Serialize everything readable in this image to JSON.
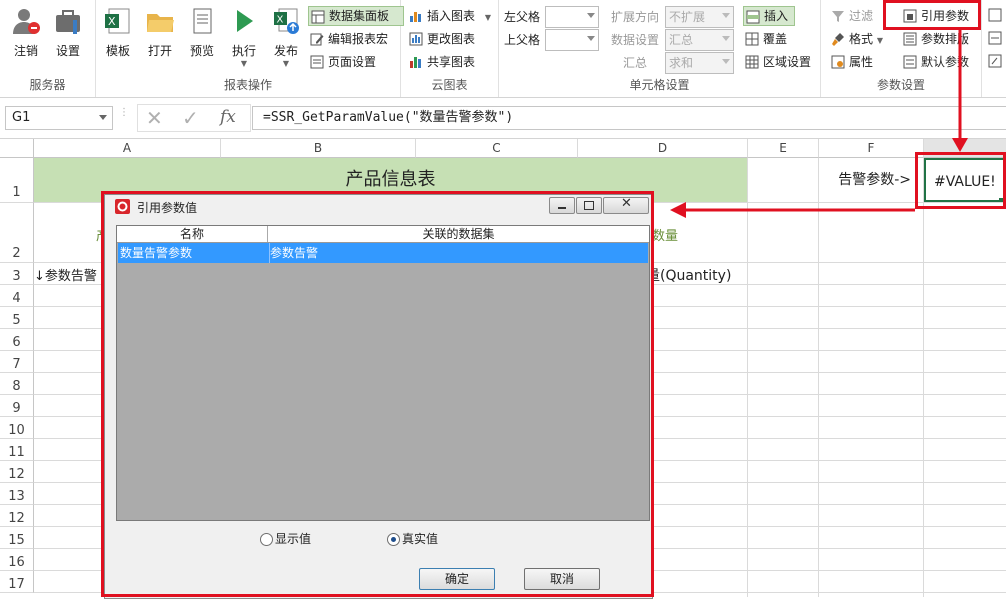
{
  "ribbon": {
    "server_group": {
      "label": "服务器",
      "logout": "注销",
      "settings": "设置"
    },
    "report_ops": {
      "label": "报表操作",
      "template": "模板",
      "open": "打开",
      "preview": "预览",
      "execute": "执行",
      "publish": "发布",
      "dataset_panel": "数据集面板",
      "edit_macro": "编辑报表宏",
      "page_setup": "页面设置"
    },
    "cloud_chart": {
      "label": "云图表",
      "insert_chart": "插入图表",
      "change_chart": "更改图表",
      "share_chart": "共享图表"
    },
    "cell_settings": {
      "label": "单元格设置",
      "left_parent": "左父格",
      "top_parent": "上父格",
      "expand_dir": "扩展方向",
      "expand_val": "不扩展",
      "data_setting": "数据设置",
      "data_val": "汇总",
      "summary": "汇总",
      "summary_val": "求和",
      "insert": "插入",
      "overwrite": "覆盖",
      "region_setting": "区域设置"
    },
    "param_settings": {
      "label": "参数设置",
      "filter": "过滤",
      "format": "格式",
      "property": "属性",
      "ref_param": "引用参数",
      "param_order": "参数排版",
      "default_param": "默认参数"
    }
  },
  "formula_bar": {
    "cell_ref": "G1",
    "fx": "fx",
    "formula": "=SSR_GetParamValue(\"数量告警参数\")"
  },
  "sheet": {
    "columns": [
      "A",
      "B",
      "C",
      "D",
      "E",
      "F"
    ],
    "rows": [
      "1",
      "2",
      "3",
      "4",
      "5",
      "6",
      "7",
      "8",
      "9",
      "10",
      "11",
      "12",
      "13",
      "12",
      "15",
      "16",
      "17"
    ],
    "title": "产品信息表",
    "alert_label": "告警参数->",
    "g1_value": "#VALUE!",
    "a2_partial": "产",
    "d2_partial": "数量",
    "a3_partial": "↓参数告警",
    "d3_partial": "量(Quantity)"
  },
  "dialog": {
    "title": "引用参数值",
    "col_name": "名称",
    "col_dataset": "关联的数据集",
    "rows": [
      {
        "name": "数量告警参数",
        "dataset": "参数告警"
      }
    ],
    "radio_display": "显示值",
    "radio_real": "真实值",
    "ok": "确定",
    "cancel": "取消"
  },
  "colors": {
    "accent_red": "#e01020",
    "header_green": "#c6e0b4",
    "selection_blue": "#3399ff",
    "list_grey": "#ababab"
  }
}
